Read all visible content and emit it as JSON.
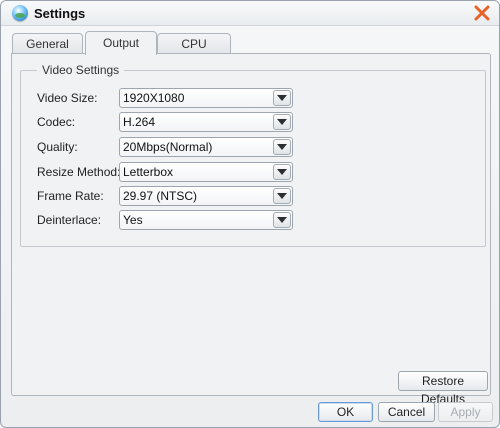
{
  "window": {
    "title": "Settings"
  },
  "tabs": [
    {
      "label": "General",
      "active": false
    },
    {
      "label": "Output",
      "active": true
    },
    {
      "label": "CPU",
      "active": false
    }
  ],
  "video_settings": {
    "group_title": "Video Settings",
    "rows": [
      {
        "label": "Video Size:",
        "value": "1920X1080"
      },
      {
        "label": "Codec:",
        "value": "H.264"
      },
      {
        "label": "Quality:",
        "value": "20Mbps(Normal)"
      },
      {
        "label": "Resize Method:",
        "value": "Letterbox"
      },
      {
        "label": "Frame Rate:",
        "value": "29.97 (NTSC)"
      },
      {
        "label": "Deinterlace:",
        "value": "Yes"
      }
    ]
  },
  "buttons": {
    "restore_defaults": "Restore Defaults",
    "ok": "OK",
    "cancel": "Cancel",
    "apply": "Apply"
  },
  "colors": {
    "close_icon": "#e8632a",
    "accent_border": "#6d9bd1"
  },
  "icons": {
    "app": "app-globe-icon",
    "close": "close-icon",
    "dropdown": "chevron-down-icon"
  }
}
